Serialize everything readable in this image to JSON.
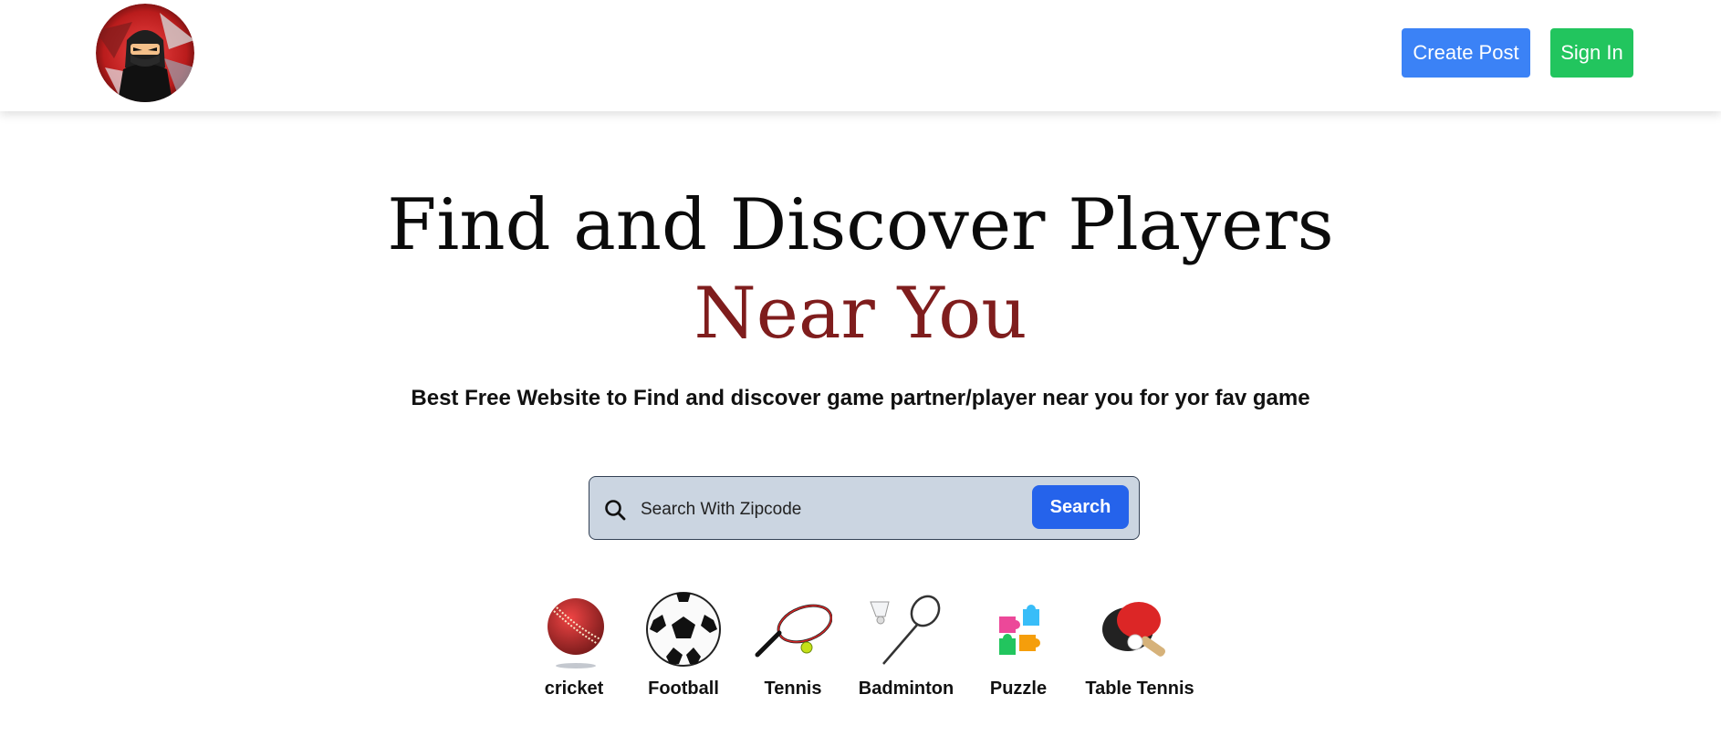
{
  "header": {
    "create_post_label": "Create Post",
    "sign_in_label": "Sign In"
  },
  "hero": {
    "title_line1": "Find and Discover Players",
    "title_line2": "Near You",
    "subtitle": "Best Free Website to Find and discover game partner/player near you for yor fav game"
  },
  "search": {
    "placeholder": "Search With Zipcode",
    "value": "",
    "button_label": "Search"
  },
  "games": [
    {
      "label": "cricket",
      "icon": "cricket-ball-icon"
    },
    {
      "label": "Football",
      "icon": "football-icon"
    },
    {
      "label": "Tennis",
      "icon": "tennis-racket-icon"
    },
    {
      "label": "Badminton",
      "icon": "badminton-icon"
    },
    {
      "label": "Puzzle",
      "icon": "puzzle-icon"
    },
    {
      "label": "Table Tennis",
      "icon": "table-tennis-icon"
    }
  ],
  "colors": {
    "create_post": "#3b82f6",
    "sign_in": "#22c55e",
    "search_button": "#2563eb",
    "accent_title": "#7f1d1d",
    "search_bg": "#cbd5e1"
  }
}
